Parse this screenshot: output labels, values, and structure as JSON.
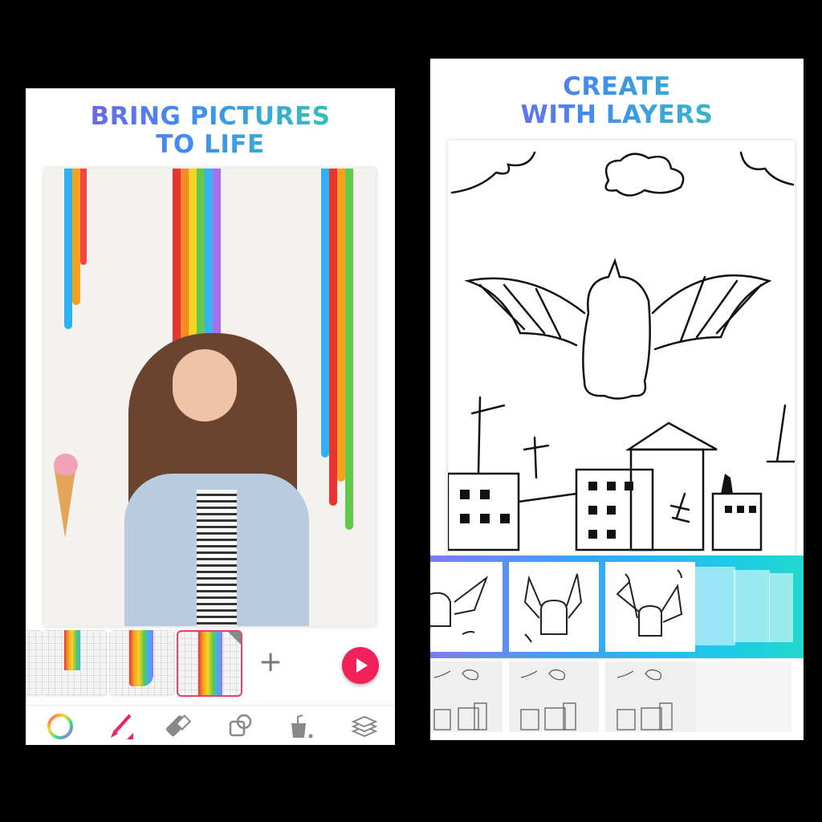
{
  "left_panel": {
    "title_line1_a": "BRING ",
    "title_line1_b": "PICTURES",
    "title_line2": "TO LIFE",
    "frames": [
      "frame-1",
      "frame-2",
      "frame-3"
    ],
    "selected_frame": 3,
    "add_frame_label": "+",
    "toolbar": [
      "color-wheel-icon",
      "brush-icon",
      "eraser-icon",
      "shapes-icon",
      "fill-bucket-icon",
      "layers-icon"
    ],
    "accent_color": "#f2215a"
  },
  "right_panel": {
    "title_line1": "CREATE",
    "title_line2": "WITH LAYERS",
    "strip_gradient": [
      "#7f7cf0",
      "#3aa3f5",
      "#22d8cc"
    ]
  }
}
